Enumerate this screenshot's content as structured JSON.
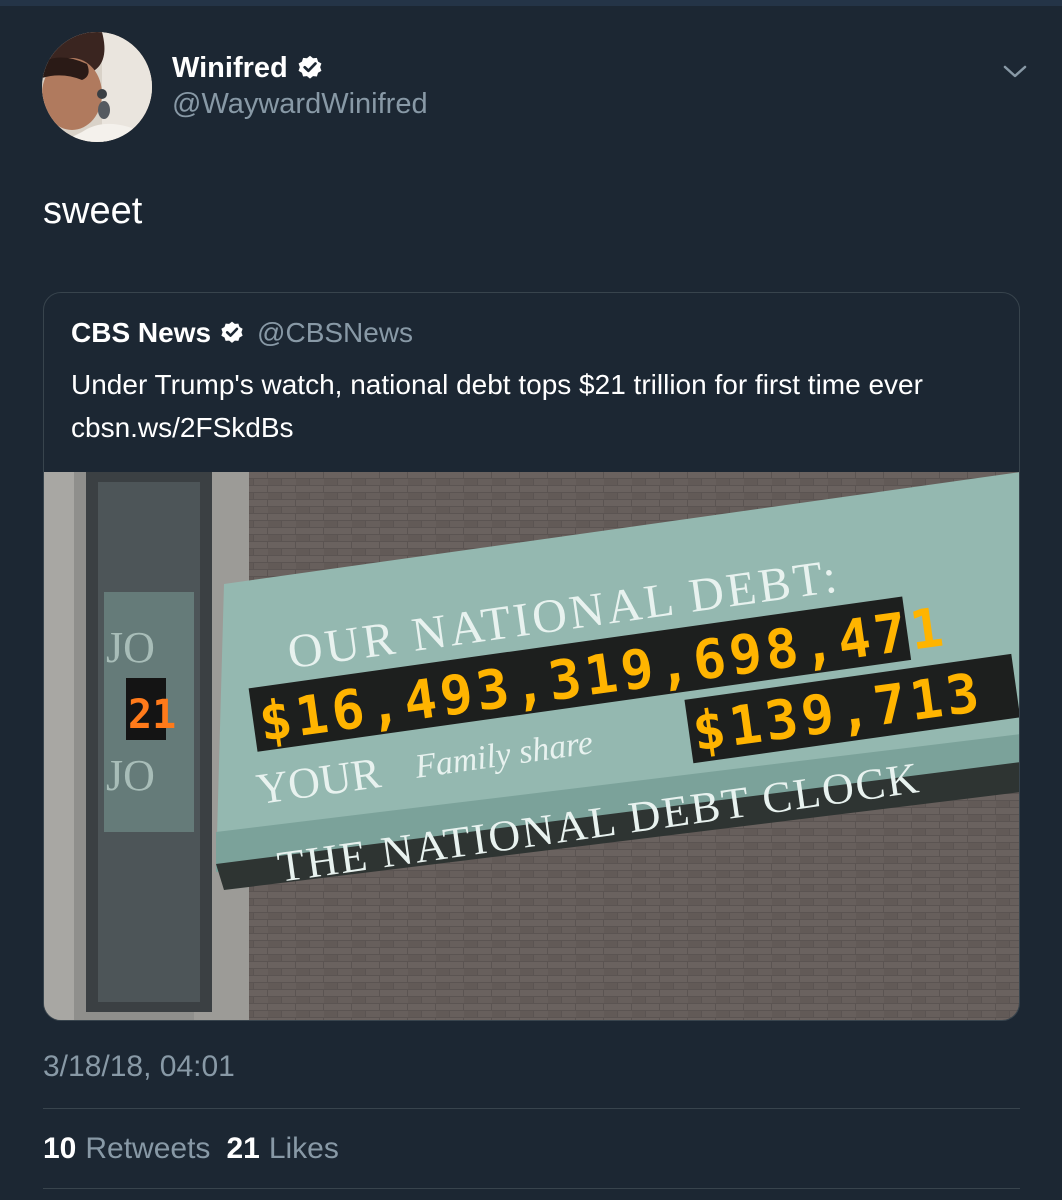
{
  "tweet": {
    "author_name": "Winifred",
    "author_handle": "@WaywardWinifred",
    "text": "sweet",
    "timestamp": "3/18/18, 04:01",
    "retweets_count": "10",
    "retweets_label": "Retweets",
    "likes_count": "21",
    "likes_label": "Likes"
  },
  "quoted": {
    "author_name": "CBS News",
    "author_handle": "@CBSNews",
    "text": "Under Trump's watch, national debt tops $21 trillion for first time ever cbsn.ws/2FSkdBs",
    "image": {
      "sign_line1": "OUR NATIONAL DEBT:",
      "sign_line2": "YOUR",
      "sign_family": "Family share",
      "sign_line3": "THE NATIONAL DEBT CLOCK",
      "debt_digits": "$16,493,319,698,471",
      "family_digits": "$139,713",
      "side_digits": "21",
      "side_text_top": "JO",
      "side_text_bottom": "JO"
    }
  },
  "colors": {
    "background": "#1c2733",
    "border": "#38444d",
    "muted": "#8899a6",
    "verified": "#ffffff",
    "led": "#ffb400"
  },
  "icons": [
    "verified-badge-icon",
    "chevron-down-icon"
  ]
}
